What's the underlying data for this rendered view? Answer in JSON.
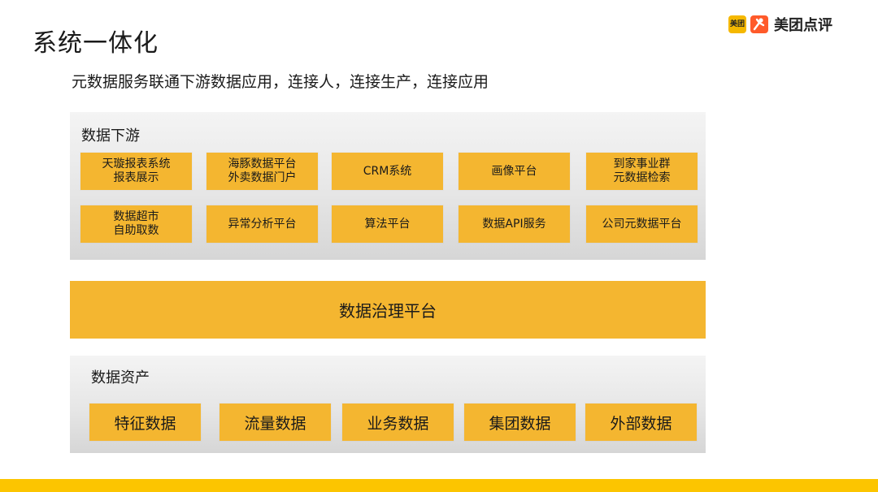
{
  "slide": {
    "title": "系统一体化",
    "subtitle": "元数据服务联通下游数据应用，连接人，连接生产，连接应用"
  },
  "logo": {
    "meituan_badge": "美团",
    "text": "美团点评",
    "colors": {
      "meituan": "#f5b800",
      "dianping": "#ff5a2a"
    }
  },
  "downstream": {
    "label": "数据下游",
    "boxes": [
      {
        "line1": "天璇报表系统",
        "line2": "报表展示"
      },
      {
        "line1": "海豚数据平台",
        "line2": "外卖数据门户"
      },
      {
        "line1": "CRM系统",
        "line2": ""
      },
      {
        "line1": "画像平台",
        "line2": ""
      },
      {
        "line1": "到家事业群",
        "line2": "元数据检索"
      },
      {
        "line1": "数据超市",
        "line2": "自助取数"
      },
      {
        "line1": "异常分析平台",
        "line2": ""
      },
      {
        "line1": "算法平台",
        "line2": ""
      },
      {
        "line1": "数据API服务",
        "line2": ""
      },
      {
        "line1": "公司元数据平台",
        "line2": ""
      }
    ]
  },
  "governance": {
    "label": "数据治理平台"
  },
  "assets": {
    "label": "数据资产",
    "boxes": [
      "特征数据",
      "流量数据",
      "业务数据",
      "集团数据",
      "外部数据"
    ]
  },
  "colors": {
    "accent": "#f4b630",
    "bottom_bar": "#fcc500",
    "panel": "#e6e6e6"
  }
}
